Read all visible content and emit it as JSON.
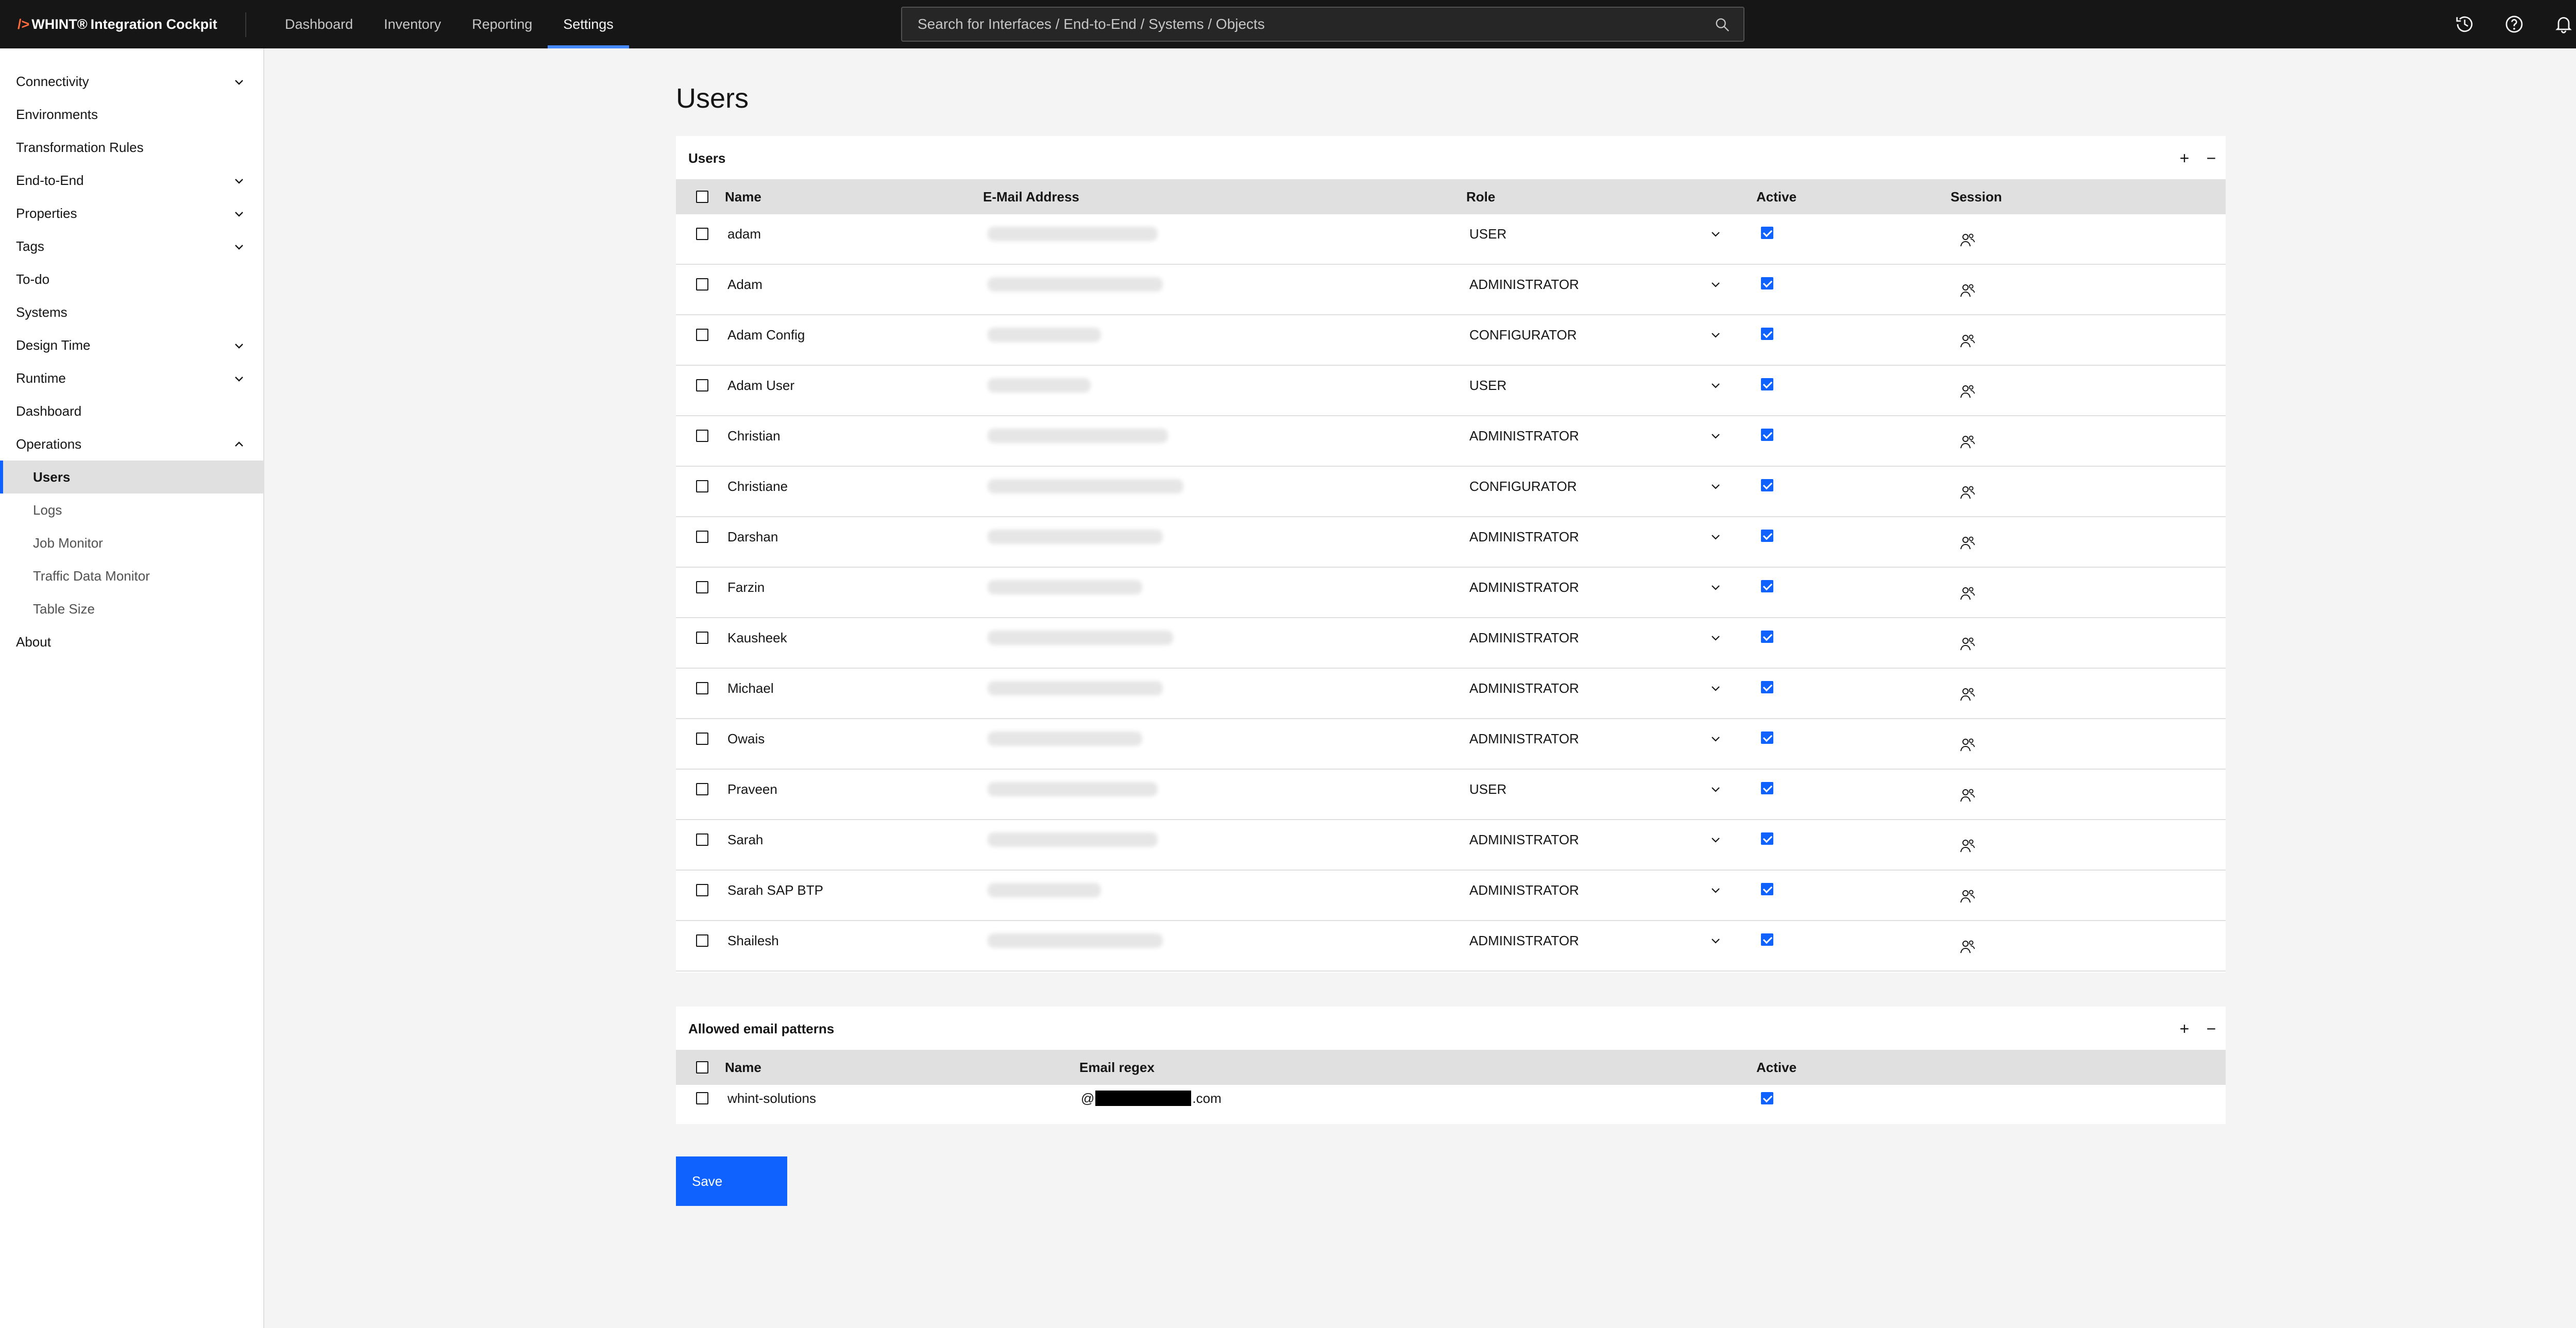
{
  "app": {
    "brand_slash": "/>",
    "brand_name": "WHINT®",
    "brand_product": "Integration Cockpit"
  },
  "topnav": [
    {
      "label": "Dashboard",
      "active": false
    },
    {
      "label": "Inventory",
      "active": false
    },
    {
      "label": "Reporting",
      "active": false
    },
    {
      "label": "Settings",
      "active": true
    }
  ],
  "search": {
    "placeholder": "Search for Interfaces / End-to-End / Systems / Objects"
  },
  "topicons": [
    "history-icon",
    "help-icon",
    "notification-icon",
    "user-avatar-icon"
  ],
  "sidebar": {
    "items": [
      {
        "label": "Connectivity",
        "expandable": true,
        "expanded": false,
        "sub": false
      },
      {
        "label": "Environments",
        "expandable": false,
        "sub": false
      },
      {
        "label": "Transformation Rules",
        "expandable": false,
        "sub": false
      },
      {
        "label": "End-to-End",
        "expandable": true,
        "expanded": false,
        "sub": false
      },
      {
        "label": "Properties",
        "expandable": true,
        "expanded": false,
        "sub": false
      },
      {
        "label": "Tags",
        "expandable": true,
        "expanded": false,
        "sub": false
      },
      {
        "label": "To-do",
        "expandable": false,
        "sub": false
      },
      {
        "label": "Systems",
        "expandable": false,
        "sub": false
      },
      {
        "label": "Design Time",
        "expandable": true,
        "expanded": false,
        "sub": false
      },
      {
        "label": "Runtime",
        "expandable": true,
        "expanded": false,
        "sub": false
      },
      {
        "label": "Dashboard",
        "expandable": false,
        "sub": false
      },
      {
        "label": "Operations",
        "expandable": true,
        "expanded": true,
        "sub": false
      },
      {
        "label": "Users",
        "expandable": false,
        "sub": true,
        "active": true
      },
      {
        "label": "Logs",
        "expandable": false,
        "sub": true
      },
      {
        "label": "Job Monitor",
        "expandable": false,
        "sub": true
      },
      {
        "label": "Traffic Data Monitor",
        "expandable": false,
        "sub": true
      },
      {
        "label": "Table Size",
        "expandable": false,
        "sub": true
      },
      {
        "label": "About",
        "expandable": false,
        "sub": false
      }
    ]
  },
  "page": {
    "title": "Users"
  },
  "users_table": {
    "title": "Users",
    "add_label": "+",
    "remove_label": "−",
    "headers": {
      "name": "Name",
      "email": "E-Mail Address",
      "role": "Role",
      "active": "Active",
      "session": "Session"
    },
    "rows": [
      {
        "name": "adam",
        "role": "USER",
        "active": true
      },
      {
        "name": "Adam",
        "role": "ADMINISTRATOR",
        "active": true
      },
      {
        "name": "Adam Config",
        "role": "CONFIGURATOR",
        "active": true
      },
      {
        "name": "Adam User",
        "role": "USER",
        "active": true
      },
      {
        "name": "Christian",
        "role": "ADMINISTRATOR",
        "active": true
      },
      {
        "name": "Christiane",
        "role": "CONFIGURATOR",
        "active": true
      },
      {
        "name": "Darshan",
        "role": "ADMINISTRATOR",
        "active": true
      },
      {
        "name": "Farzin",
        "role": "ADMINISTRATOR",
        "active": true
      },
      {
        "name": "Kausheek",
        "role": "ADMINISTRATOR",
        "active": true
      },
      {
        "name": "Michael",
        "role": "ADMINISTRATOR",
        "active": true
      },
      {
        "name": "Owais",
        "role": "ADMINISTRATOR",
        "active": true
      },
      {
        "name": "Praveen",
        "role": "USER",
        "active": true
      },
      {
        "name": "Sarah",
        "role": "ADMINISTRATOR",
        "active": true
      },
      {
        "name": "Sarah SAP BTP",
        "role": "ADMINISTRATOR",
        "active": true
      },
      {
        "name": "Shailesh",
        "role": "ADMINISTRATOR",
        "active": true
      }
    ]
  },
  "patterns_table": {
    "title": "Allowed email patterns",
    "add_label": "+",
    "remove_label": "−",
    "headers": {
      "name": "Name",
      "regex": "Email regex",
      "active": "Active"
    },
    "rows": [
      {
        "name": "whint-solutions",
        "regex_prefix": "@",
        "regex_suffix": ".com",
        "active": true
      }
    ]
  },
  "save_label": "Save"
}
